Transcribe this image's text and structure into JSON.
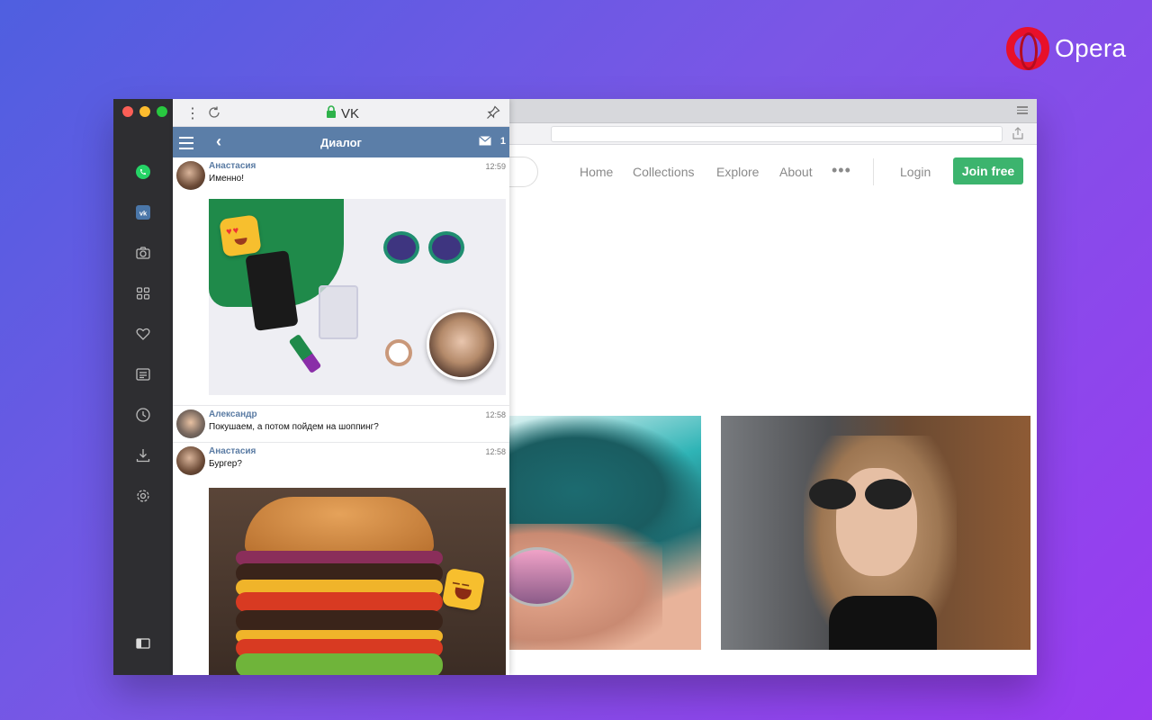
{
  "brand": {
    "name": "Opera",
    "color": "#e8102a"
  },
  "sidebar": {
    "icons": [
      "whatsapp-icon",
      "vk-icon",
      "camera-icon",
      "grid-icon",
      "heart-icon",
      "news-icon",
      "history-icon",
      "download-icon",
      "settings-icon",
      "sidebar-toggle-icon"
    ]
  },
  "site": {
    "nav": {
      "home": "Home",
      "collections": "Collections",
      "explore": "Explore",
      "about": "About",
      "more": "•••",
      "login": "Login",
      "join": "Join free"
    },
    "accent": "#3cb46e"
  },
  "panel": {
    "menu": "⋮",
    "title": "VK",
    "header": {
      "title": "Диалог",
      "back": "‹",
      "unread_count": "1"
    },
    "messages": [
      {
        "author": "Анастасия",
        "time": "12:59",
        "text": "Именно!"
      },
      {
        "author": "Александр",
        "time": "12:58",
        "text": "Покушаем, а потом пойдем на шоппинг?"
      },
      {
        "author": "Анастасия",
        "time": "12:58",
        "text": "Бургер?"
      }
    ],
    "header_color": "#5b7ea8"
  }
}
